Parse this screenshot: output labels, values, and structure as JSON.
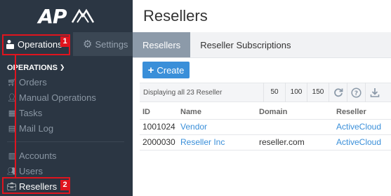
{
  "logo": {
    "text": "AP"
  },
  "sidebar": {
    "top_tabs": [
      {
        "label": "Operations",
        "icon": "briefcase-person-icon"
      },
      {
        "label": "Settings",
        "icon": "gear-icon"
      }
    ],
    "section_title": "OPERATIONS",
    "items": [
      {
        "label": "Orders",
        "icon": "cart-icon"
      },
      {
        "label": "Manual Operations",
        "icon": "user-gear-icon"
      },
      {
        "label": "Tasks",
        "icon": "calendar-icon"
      },
      {
        "label": "Mail Log",
        "icon": "list-icon"
      },
      {
        "label": "Accounts",
        "icon": "building-icon"
      },
      {
        "label": "Users",
        "icon": "users-icon"
      },
      {
        "label": "Resellers",
        "icon": "briefcase-icon"
      }
    ]
  },
  "annotations": [
    "1",
    "2"
  ],
  "main": {
    "title": "Resellers",
    "tabs": [
      "Resellers",
      "Reseller Subscriptions"
    ],
    "create_label": "Create",
    "toolbar": {
      "info": "Displaying all 23 Reseller",
      "page_sizes": [
        "50",
        "100",
        "150"
      ]
    },
    "table": {
      "headers": [
        "ID",
        "Name",
        "Domain",
        "Reseller"
      ],
      "rows": [
        [
          "1001024",
          "Vendor",
          "",
          "ActiveCloud"
        ],
        [
          "2000030",
          "Reseller Inc",
          "reseller.com",
          "ActiveCloud"
        ]
      ]
    }
  },
  "colors": {
    "sidebar": "#2b3643",
    "accent": "#3a8fd9",
    "annotation": "#e0141e",
    "active_tab": "#8c9aa9"
  }
}
